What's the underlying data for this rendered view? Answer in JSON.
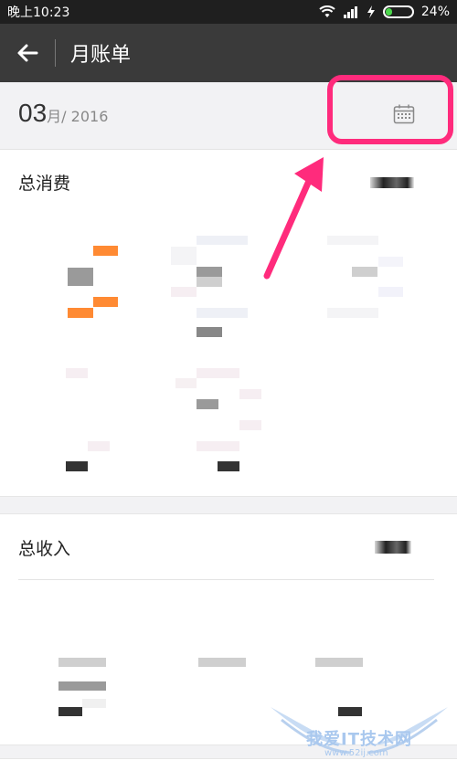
{
  "status_bar": {
    "time": "晚上10:23",
    "battery": "24%",
    "battery_level": 0.24,
    "battery_color": "#4cd84c"
  },
  "header": {
    "title": "月账单"
  },
  "date": {
    "month": "03",
    "month_unit": "月",
    "year": "/ 2016"
  },
  "expense": {
    "label": "总消费"
  },
  "income": {
    "label": "总收入"
  },
  "colors": {
    "accent": "#ff8a33",
    "highlight": "#ff2b7c",
    "title_bar": "#3a3a3a"
  },
  "watermark": {
    "main": "我爱IT技术网",
    "sub": "www.52ij.com"
  }
}
